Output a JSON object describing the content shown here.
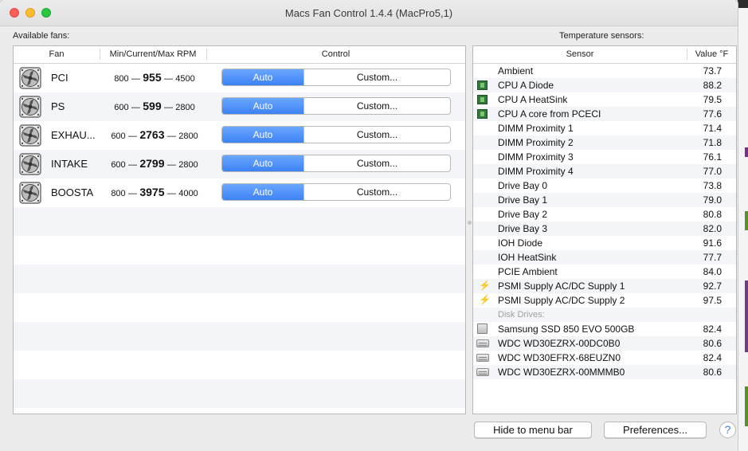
{
  "window": {
    "title": "Macs Fan Control 1.4.4 (MacPro5,1)"
  },
  "fans": {
    "section_label": "Available fans:",
    "columns": {
      "fan": "Fan",
      "rpm": "Min/Current/Max RPM",
      "control": "Control"
    },
    "rows": [
      {
        "name": "PCI",
        "min": "800",
        "current": "955",
        "max": "4500",
        "auto_label": "Auto",
        "custom_label": "Custom..."
      },
      {
        "name": "PS",
        "min": "600",
        "current": "599",
        "max": "2800",
        "auto_label": "Auto",
        "custom_label": "Custom..."
      },
      {
        "name": "EXHAU...",
        "min": "600",
        "current": "2763",
        "max": "2800",
        "auto_label": "Auto",
        "custom_label": "Custom..."
      },
      {
        "name": "INTAKE",
        "min": "600",
        "current": "2799",
        "max": "2800",
        "auto_label": "Auto",
        "custom_label": "Custom..."
      },
      {
        "name": "BOOSTA",
        "min": "800",
        "current": "3975",
        "max": "4000",
        "auto_label": "Auto",
        "custom_label": "Custom..."
      }
    ],
    "dash": "—",
    "selected_mode": "Auto"
  },
  "sensors": {
    "section_label": "Temperature sensors:",
    "columns": {
      "sensor": "Sensor",
      "value": "Value °F"
    },
    "rows": [
      {
        "name": "Ambient",
        "value": "73.7",
        "icon": "none"
      },
      {
        "name": "CPU A Diode",
        "value": "88.2",
        "icon": "chip"
      },
      {
        "name": "CPU A HeatSink",
        "value": "79.5",
        "icon": "chip"
      },
      {
        "name": "CPU A core from PCECI",
        "value": "77.6",
        "icon": "chip"
      },
      {
        "name": "DIMM Proximity 1",
        "value": "71.4",
        "icon": "none"
      },
      {
        "name": "DIMM Proximity 2",
        "value": "71.8",
        "icon": "none"
      },
      {
        "name": "DIMM Proximity 3",
        "value": "76.1",
        "icon": "none"
      },
      {
        "name": "DIMM Proximity 4",
        "value": "77.0",
        "icon": "none"
      },
      {
        "name": "Drive Bay 0",
        "value": "73.8",
        "icon": "none"
      },
      {
        "name": "Drive Bay 1",
        "value": "79.0",
        "icon": "none"
      },
      {
        "name": "Drive Bay 2",
        "value": "80.8",
        "icon": "none"
      },
      {
        "name": "Drive Bay 3",
        "value": "82.0",
        "icon": "none"
      },
      {
        "name": "IOH Diode",
        "value": "91.6",
        "icon": "none"
      },
      {
        "name": "IOH HeatSink",
        "value": "77.7",
        "icon": "none"
      },
      {
        "name": "PCIE Ambient",
        "value": "84.0",
        "icon": "none"
      },
      {
        "name": "PSMI Supply AC/DC Supply 1",
        "value": "92.7",
        "icon": "bolt"
      },
      {
        "name": "PSMI Supply AC/DC Supply 2",
        "value": "97.5",
        "icon": "bolt"
      },
      {
        "name": "Disk Drives:",
        "value": "",
        "icon": "group"
      },
      {
        "name": "Samsung SSD 850 EVO 500GB",
        "value": "82.4",
        "icon": "ssd"
      },
      {
        "name": "WDC WD30EZRX-00DC0B0",
        "value": "80.6",
        "icon": "hdd"
      },
      {
        "name": "WDC WD30EFRX-68EUZN0",
        "value": "82.4",
        "icon": "hdd"
      },
      {
        "name": "WDC WD30EZRX-00MMMB0",
        "value": "80.6",
        "icon": "hdd"
      }
    ]
  },
  "buttons": {
    "hide": "Hide to menu bar",
    "preferences": "Preferences...",
    "help": "?"
  },
  "icons": {
    "fan": "fan-icon",
    "chip": "cpu-chip-icon",
    "bolt": "power-supply-bolt-icon",
    "ssd": "ssd-drive-icon",
    "hdd": "hard-drive-icon"
  },
  "colors": {
    "accent": "#3d82f5",
    "row_alt": "#f3f5f9",
    "chip": "#2f7a3a",
    "bolt": "#e4b100"
  }
}
